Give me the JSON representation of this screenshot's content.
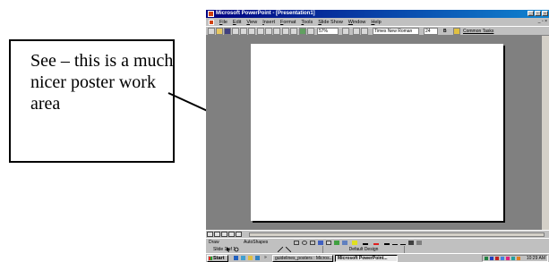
{
  "callout": {
    "text": "See – this is a much nicer poster work area"
  },
  "window": {
    "title": "Microsoft PowerPoint - [Presentation1]",
    "controls": {
      "minimize": "_",
      "restore": "▫",
      "close": "×"
    },
    "menu": [
      "File",
      "Edit",
      "View",
      "Insert",
      "Format",
      "Tools",
      "Slide Show",
      "Window",
      "Help"
    ],
    "menu_right_controls": "_ ▫ ×"
  },
  "toolbar": {
    "zoom": "57%",
    "font_name": "Times New Roman",
    "font_size": "24",
    "bold": "B",
    "common_tasks": "Common Tasks"
  },
  "drawing_toolbar": {
    "draw": "Draw",
    "autoshapes": "AutoShapes"
  },
  "statusbar": {
    "slide_info": "Slide 1 of 1",
    "design": "Default Design"
  },
  "taskbar": {
    "start": "Start",
    "buttons": [
      "guidelines_posters : Micros...",
      "Microsoft PowerPoint..."
    ],
    "clock": "10:29 AM",
    "more": "»"
  },
  "colors": {
    "title_bar": "#000080",
    "workspace": "#808080",
    "chrome": "#c0c0c0"
  }
}
